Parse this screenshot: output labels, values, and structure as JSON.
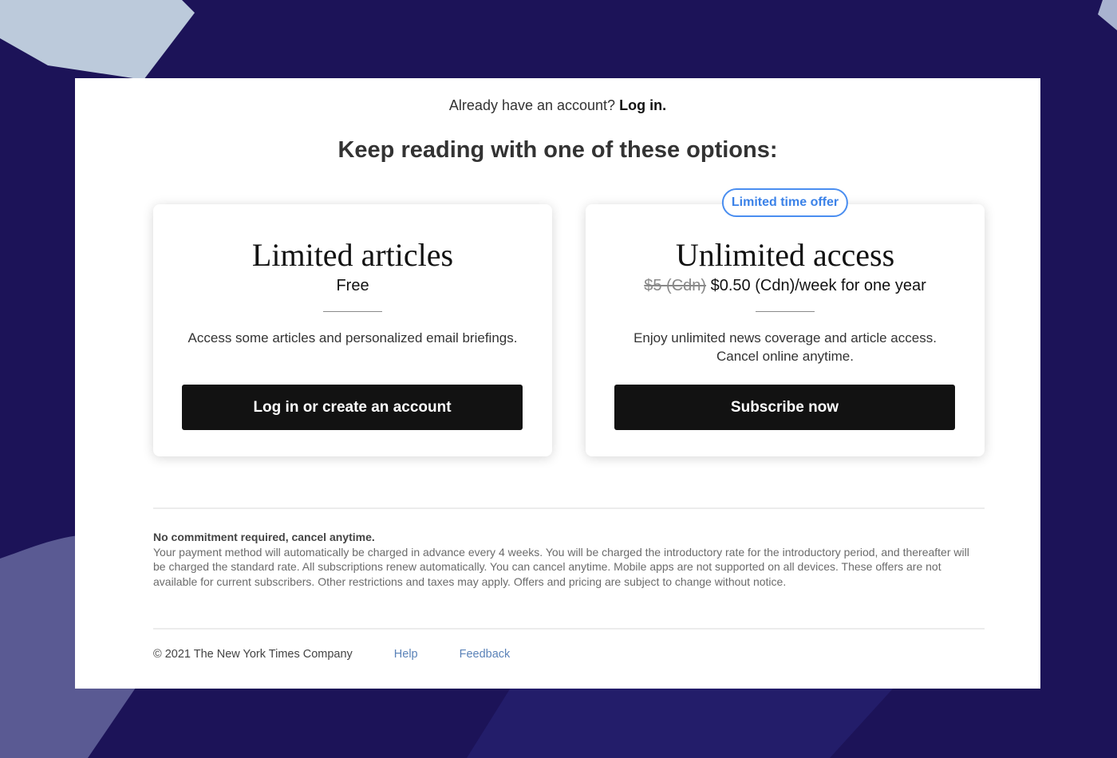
{
  "login": {
    "prompt": "Already have an account?",
    "link": "Log in."
  },
  "headline": "Keep reading with one of these options:",
  "cards": [
    {
      "title": "Limited articles",
      "price": "Free",
      "description": "Access some articles and personalized email briefings.",
      "button": "Log in or create an account"
    },
    {
      "badge": "Limited time offer",
      "title": "Unlimited access",
      "old_price": "$5 (Cdn)",
      "price": "$0.50 (Cdn)/week for one year",
      "description": "Enjoy unlimited news coverage and article access. Cancel online anytime.",
      "button": "Subscribe now"
    }
  ],
  "terms": {
    "title": "No commitment required, cancel anytime.",
    "body": "Your payment method will automatically be charged in advance every 4 weeks. You will be charged the introductory rate for the introductory period, and thereafter will be charged the standard rate. All subscriptions renew automatically. You can cancel anytime. Mobile apps are not supported on all devices. These offers are not available for current subscribers. Other restrictions and taxes may apply. Offers and pricing are subject to change without notice."
  },
  "footer": {
    "copyright": "© 2021 The New York Times Company",
    "help": "Help",
    "feedback": "Feedback"
  },
  "colors": {
    "background": "#1c1358",
    "shape_light": "#bccadb",
    "shape_mid": "#5a5a93",
    "shape_dark": "#231d6a",
    "badge_accent": "#3b82e8",
    "button": "#121212"
  }
}
